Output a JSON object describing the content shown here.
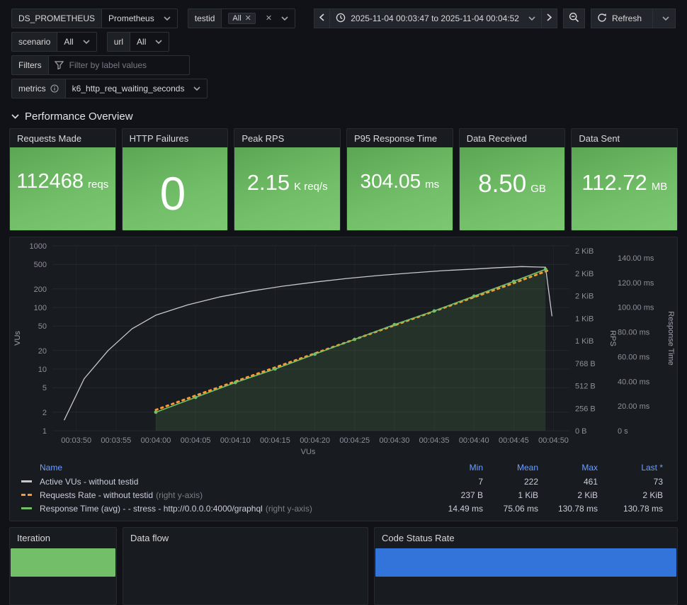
{
  "toolbar": {
    "ds_label": "DS_PROMETHEUS",
    "ds_value": "Prometheus",
    "testid_label": "testid",
    "testid_chip": "All",
    "scenario_label": "scenario",
    "scenario_value": "All",
    "url_label": "url",
    "url_value": "All",
    "filters_label": "Filters",
    "filters_placeholder": "Filter by label values",
    "metrics_label": "metrics",
    "metrics_value": "k6_http_req_waiting_seconds",
    "time_range": "2025-11-04 00:03:47 to 2025-11-04 00:04:52",
    "refresh_label": "Refresh"
  },
  "icons": {
    "dropdown": "chevron-down",
    "clear": "x",
    "time_nav_back": "chevron-left",
    "time_nav_forward": "chevron-right",
    "time_range": "clock",
    "zoom_out": "magnifier-minus",
    "refresh": "circular-arrow",
    "filter": "funnel",
    "info": "circle-i",
    "section_collapse": "chevron-down"
  },
  "section": {
    "title": "Performance Overview"
  },
  "stats": [
    {
      "title": "Requests Made",
      "value": "112468",
      "suffix": "reqs"
    },
    {
      "title": "HTTP Failures",
      "value": "0",
      "suffix": ""
    },
    {
      "title": "Peak RPS",
      "value": "2.15",
      "suffix": "K req/s"
    },
    {
      "title": "P95 Response Time",
      "value": "304.05",
      "suffix": "ms"
    },
    {
      "title": "Data Received",
      "value": "8.50",
      "suffix": "GB"
    },
    {
      "title": "Data Sent",
      "value": "112.72",
      "suffix": "MB"
    }
  ],
  "chart_data": {
    "type": "line",
    "x_axis": {
      "label": "VUs",
      "domain_s": [
        227,
        292
      ],
      "ticks": [
        {
          "t": 230,
          "label": "00:03:50"
        },
        {
          "t": 235,
          "label": "00:03:55"
        },
        {
          "t": 240,
          "label": "00:04:00"
        },
        {
          "t": 245,
          "label": "00:04:05"
        },
        {
          "t": 250,
          "label": "00:04:10"
        },
        {
          "t": 255,
          "label": "00:04:15"
        },
        {
          "t": 260,
          "label": "00:04:20"
        },
        {
          "t": 265,
          "label": "00:04:25"
        },
        {
          "t": 270,
          "label": "00:04:30"
        },
        {
          "t": 275,
          "label": "00:04:35"
        },
        {
          "t": 280,
          "label": "00:04:40"
        },
        {
          "t": 285,
          "label": "00:04:45"
        },
        {
          "t": 290,
          "label": "00:04:50"
        }
      ]
    },
    "left_axis": {
      "label": "VUs",
      "scale": "log",
      "ticks": [
        1,
        2,
        5,
        10,
        20,
        50,
        100,
        200,
        500,
        1000
      ]
    },
    "bytes_axis": {
      "label": "RPS",
      "min": 0,
      "max": 2048,
      "step": 256,
      "tick_labels": [
        "0 B",
        "256 B",
        "512 B",
        "768 B",
        "1 KiB",
        "1 KiB",
        "2 KiB",
        "2 KiB",
        "2 KiB"
      ]
    },
    "ms_axis": {
      "label": "Response Time",
      "min": 0,
      "max": 140,
      "step": 20,
      "tick_labels": [
        "0 s",
        "20.00 ms",
        "40.00 ms",
        "60.00 ms",
        "80.00 ms",
        "100.00 ms",
        "120.00 ms",
        "140.00 ms"
      ]
    },
    "series": [
      {
        "name": "Active VUs - without testid",
        "axis": "left",
        "color": "#c7c8cc",
        "width": 1.3,
        "style": "solid",
        "markers": false,
        "fill": false,
        "points": [
          [
            228.5,
            1.5
          ],
          [
            231,
            7
          ],
          [
            234,
            20
          ],
          [
            237,
            45
          ],
          [
            240,
            75
          ],
          [
            244,
            110
          ],
          [
            248,
            148
          ],
          [
            252,
            185
          ],
          [
            256,
            222
          ],
          [
            260,
            258
          ],
          [
            264,
            295
          ],
          [
            268,
            330
          ],
          [
            272,
            362
          ],
          [
            276,
            395
          ],
          [
            280,
            420
          ],
          [
            283,
            442
          ],
          [
            286,
            461
          ],
          [
            289,
            450
          ],
          [
            289.8,
            73
          ]
        ]
      },
      {
        "name": "Requests Rate - without testid",
        "axis": "bytes",
        "color": "#ff9830",
        "width": 3,
        "style": "dotted",
        "markers": false,
        "fill": false,
        "points": [
          [
            240,
            237
          ],
          [
            245,
            400
          ],
          [
            250,
            560
          ],
          [
            255,
            720
          ],
          [
            260,
            880
          ],
          [
            265,
            1040
          ],
          [
            270,
            1200
          ],
          [
            275,
            1360
          ],
          [
            280,
            1520
          ],
          [
            285,
            1680
          ],
          [
            289.5,
            1830
          ]
        ]
      },
      {
        "name": "Response Time (avg) - - stress - http://0.0.0.0:4000/graphql",
        "axis": "ms",
        "color": "#73bf69",
        "width": 1.6,
        "style": "solid",
        "markers": true,
        "fill": true,
        "fill_color": "rgba(115,191,105,0.14)",
        "points": [
          [
            240,
            15
          ],
          [
            245,
            27
          ],
          [
            250,
            39
          ],
          [
            255,
            50
          ],
          [
            260,
            62
          ],
          [
            265,
            74
          ],
          [
            270,
            86
          ],
          [
            275,
            97
          ],
          [
            280,
            109
          ],
          [
            285,
            121
          ],
          [
            289,
            130.78
          ]
        ]
      }
    ]
  },
  "legend": {
    "headers": {
      "name": "Name",
      "min": "Min",
      "mean": "Mean",
      "max": "Max",
      "last": "Last *"
    },
    "rows": [
      {
        "name": "Active VUs - without testid",
        "suffix": "",
        "min": "7",
        "mean": "222",
        "max": "461",
        "last": "73",
        "color": "#c7c8cc",
        "style": "solid"
      },
      {
        "name": "Requests Rate - without testid",
        "suffix": "(right y-axis)",
        "min": "237 B",
        "mean": "1 KiB",
        "max": "2 KiB",
        "last": "2 KiB",
        "color": "#ff9830",
        "style": "dashed"
      },
      {
        "name": "Response Time (avg) - - stress - http://0.0.0.0:4000/graphql",
        "suffix": "(right y-axis)",
        "min": "14.49 ms",
        "mean": "75.06 ms",
        "max": "130.78 ms",
        "last": "130.78 ms",
        "color": "#73bf69",
        "style": "solid"
      }
    ]
  },
  "bottom": {
    "iteration": {
      "title": "Iteration",
      "bar_color": "#73bf69"
    },
    "data_flow": {
      "title": "Data flow"
    },
    "code_status": {
      "title": "Code Status Rate",
      "bar_color": "#3274d9"
    }
  }
}
